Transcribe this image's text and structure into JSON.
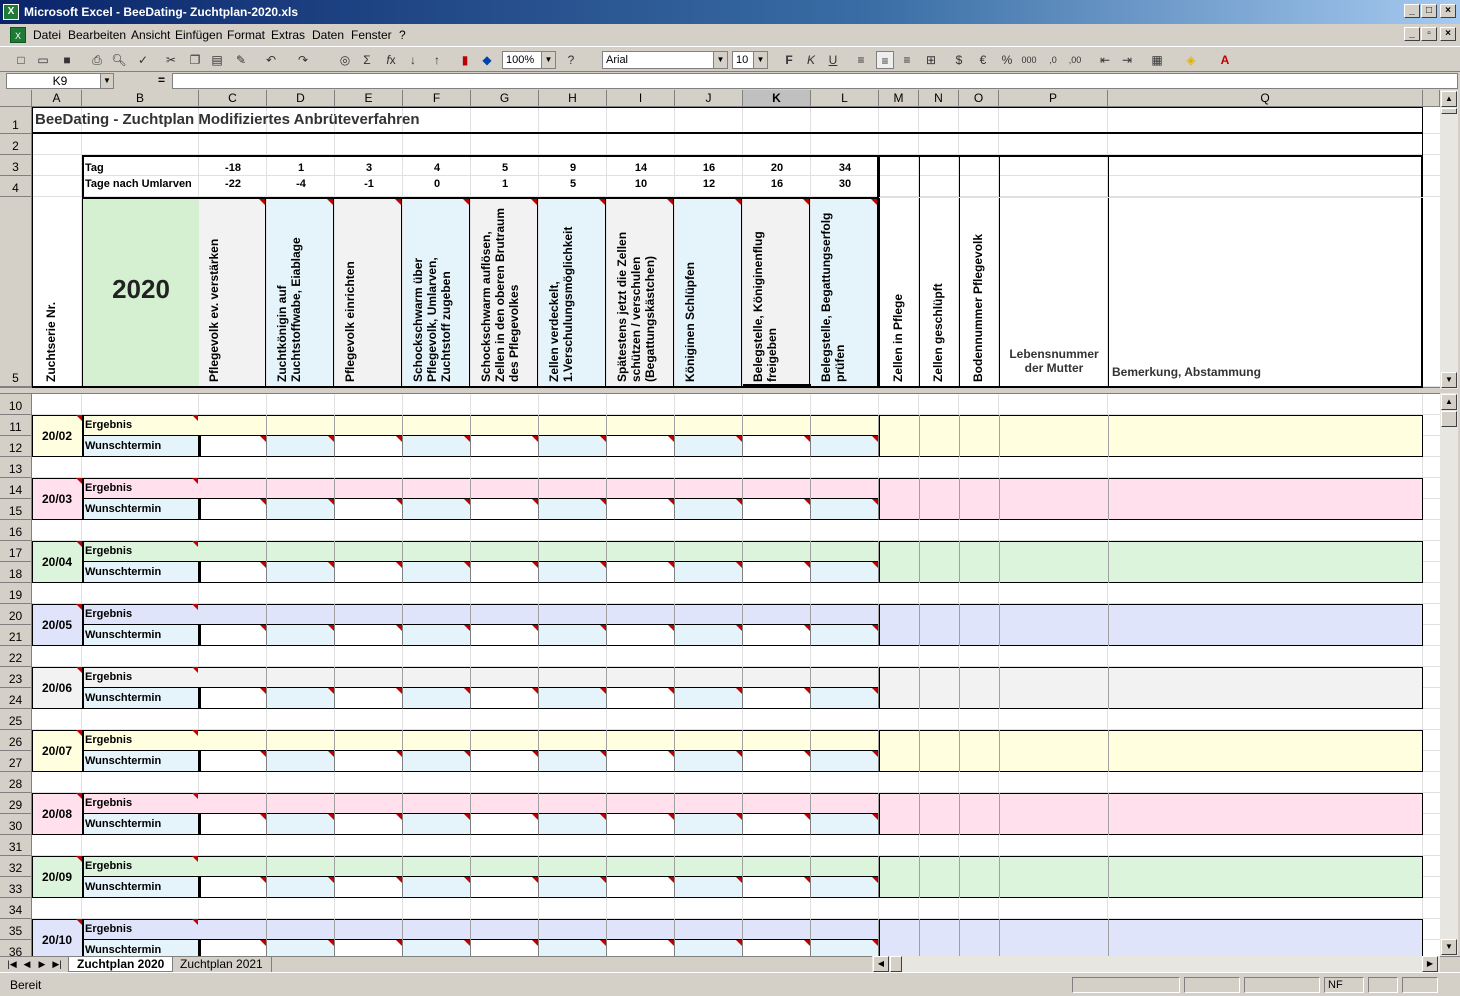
{
  "window": {
    "title": "Microsoft Excel - BeeDating- Zuchtplan-2020.xls",
    "app_icon": "excel-icon"
  },
  "menu": [
    "Datei",
    "Bearbeiten",
    "Ansicht",
    "Einfügen",
    "Format",
    "Extras",
    "Daten",
    "Fenster",
    "?"
  ],
  "toolbar": {
    "zoom": "100%",
    "font": "Arial",
    "size": "10"
  },
  "formula": {
    "cell_ref": "K9",
    "eq": "=",
    "content": ""
  },
  "columns": [
    "A",
    "B",
    "C",
    "D",
    "E",
    "F",
    "G",
    "H",
    "I",
    "J",
    "K",
    "L",
    "M",
    "N",
    "O",
    "P",
    "Q"
  ],
  "rows_top": [
    "1",
    "2",
    "3",
    "4",
    "5"
  ],
  "rows_bottom": [
    "10",
    "11",
    "12",
    "13",
    "14",
    "15",
    "16",
    "17",
    "18",
    "19",
    "20",
    "21",
    "22",
    "23",
    "24",
    "25",
    "26",
    "27",
    "28",
    "29",
    "30",
    "31",
    "32",
    "33",
    "34",
    "35",
    "36"
  ],
  "sheet": {
    "title": "BeeDating - Zuchtplan Modifiziertes Anbrüteverfahren",
    "tag_label": "Tag",
    "tage_label": "Tage nach Umlarven",
    "tag_values": [
      "-18",
      "1",
      "3",
      "4",
      "5",
      "9",
      "14",
      "16",
      "20",
      "34"
    ],
    "tage_values": [
      "-22",
      "-4",
      "-1",
      "0",
      "1",
      "5",
      "10",
      "12",
      "16",
      "30"
    ],
    "year": "2020",
    "serie_header": "Zuchtserie Nr.",
    "step_headers": [
      "Pflegevolk ev. verstärken",
      "Zuchtkönigin auf Zuchtstoffwabe, Eiablage",
      "Pflegevolk einrichten",
      "Schockschwarm über Pflegevolk, Umlarven, Zuchtstoff zugeben",
      "Schockschwarm auflösen, Zellen in den oberen Brutraum des Pflegevolkes",
      "Zellen verdeckelt, 1.Verschulungsmöglichkeit",
      "Spätestens jetzt die Zellen schützen / verschulen (Begattungskästchen)",
      "Königinen Schlüpfen",
      "Belegstelle, Königinenflug freigeben",
      "Belegstelle, Begattungserfolg prüfen"
    ],
    "extra_headers": [
      "Zellen in Pflege",
      "Zellen geschlüpft",
      "Bodennummer Pflegevolk"
    ],
    "mother_header": "Lebensnummer der Mutter",
    "remark_header": "Bemerkung, Abstammung",
    "result_label": "Ergebnis",
    "wish_label": "Wunschtermin",
    "series": [
      "20/02",
      "20/03",
      "20/04",
      "20/05",
      "20/06",
      "20/07",
      "20/08",
      "20/09",
      "20/10"
    ]
  },
  "colors": {
    "series": [
      "#ffffe0",
      "#ffe0ec",
      "#dcf4dc",
      "#e0e4fa",
      "#f2f2f2",
      "#ffffe0",
      "#ffe0ec",
      "#dcf4dc",
      "#e0e4fa"
    ],
    "wish": "#e4f4fa",
    "header_green": "#d4f0d0",
    "header_cyan": "#e4f4fa",
    "header_gray": "#f2f2f2",
    "comment_marker": "#c00000"
  },
  "tabs": [
    "Zuchtplan 2020",
    "Zuchtplan 2021"
  ],
  "status": {
    "text": "Bereit",
    "nf": "NF"
  }
}
